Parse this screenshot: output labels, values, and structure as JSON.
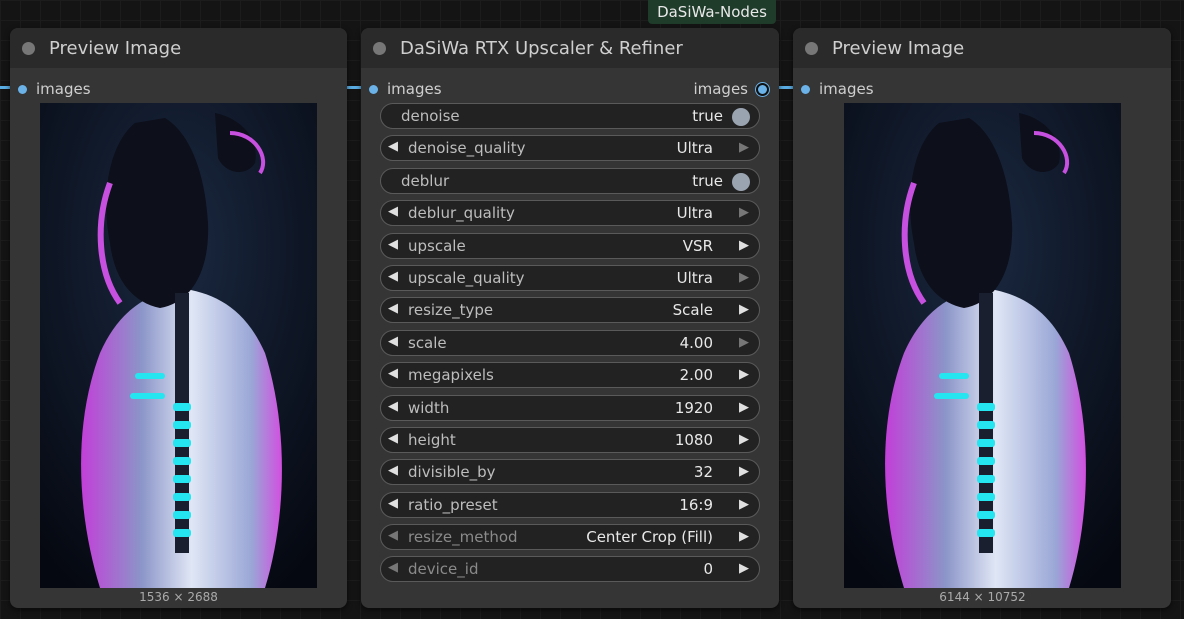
{
  "badge": "DaSiWa-Nodes",
  "left_node": {
    "title": "Preview Image",
    "input": "images",
    "dims": "1536 × 2688"
  },
  "mid_node": {
    "title": "DaSiWa RTX Upscaler & Refiner",
    "input": "images",
    "output": "images",
    "widgets": [
      {
        "label": "denoise",
        "value": "true"
      },
      {
        "label": "denoise_quality",
        "value": "Ultra"
      },
      {
        "label": "deblur",
        "value": "true"
      },
      {
        "label": "deblur_quality",
        "value": "Ultra"
      },
      {
        "label": "upscale",
        "value": "VSR"
      },
      {
        "label": "upscale_quality",
        "value": "Ultra"
      },
      {
        "label": "resize_type",
        "value": "Scale"
      },
      {
        "label": "scale",
        "value": "4.00"
      },
      {
        "label": "megapixels",
        "value": "2.00"
      },
      {
        "label": "width",
        "value": "1920"
      },
      {
        "label": "height",
        "value": "1080"
      },
      {
        "label": "divisible_by",
        "value": "32"
      },
      {
        "label": "ratio_preset",
        "value": "16:9"
      },
      {
        "label": "resize_method",
        "value": "Center Crop (Fill)"
      },
      {
        "label": "device_id",
        "value": "0"
      }
    ]
  },
  "right_node": {
    "title": "Preview Image",
    "input": "images",
    "dims": "6144 × 10752"
  },
  "colors": {
    "slot": "#6ab2e8",
    "badge_bg": "#1f3b2a",
    "node_bg": "#353535"
  }
}
